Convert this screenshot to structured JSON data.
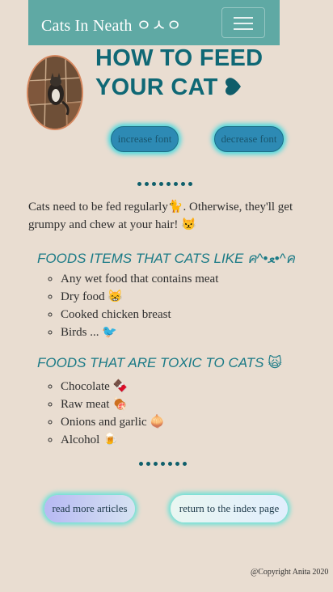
{
  "navbar": {
    "brand": "Cats In Neath ㅇㅅㅇ",
    "toggler_icon": "hamburger-menu-icon"
  },
  "header": {
    "title_line1": "HOW TO FEED",
    "title_line2": "YOUR CAT",
    "title_emoji": "heart-icon"
  },
  "controls": {
    "increase_label": "increase font",
    "decrease_label": "decrease font"
  },
  "intro": "Cats need to be fed regularly🐈. Otherwise, they'll get grumpy and chew at your hair! 😾",
  "likes": {
    "heading": "FOODS ITEMS THAT CATS LIKE ค^•ﻌ•^ค",
    "items": [
      "Any wet food that contains meat",
      "Dry food 😸",
      "Cooked chicken breast",
      "Birds ... 🐦"
    ]
  },
  "toxic": {
    "heading": "FOODS THAT ARE TOXIC TO CATS 🙀",
    "items": [
      "Chocolate 🍫",
      "Raw meat 🍖",
      "Onions and garlic 🧅",
      "Alcohol 🍺"
    ]
  },
  "links": {
    "read_more": "read more articles",
    "return_index": "return to the index page"
  },
  "footer": {
    "copyright": "@Copyright Anita 2020"
  },
  "colors": {
    "background": "#e9ddd1",
    "navbar": "#5fa9a4",
    "title": "#0f6875",
    "heading": "#1a7a86",
    "button_glow": "#49d8df"
  }
}
